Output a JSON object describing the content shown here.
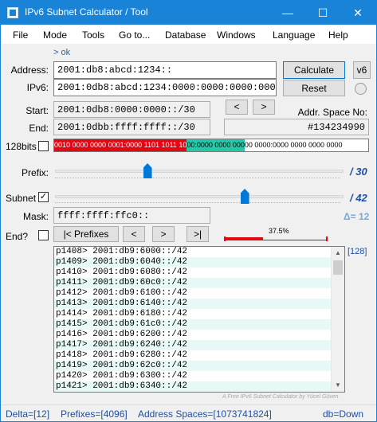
{
  "window": {
    "title": "IPv6 Subnet Calculator / Tool",
    "minimize": "—",
    "maximize": "☐",
    "close": "✕"
  },
  "menu": [
    "File",
    "Mode",
    "Tools",
    "Go to...",
    "Database",
    "Windows",
    "Language",
    "Help"
  ],
  "ok_link": "> ok",
  "address": {
    "label": "Address:",
    "value": "2001:db8:abcd:1234::"
  },
  "ipv6": {
    "label": "IPv6:",
    "value": "2001:0db8:abcd:1234:0000:0000:0000:0000"
  },
  "buttons": {
    "calculate": "Calculate",
    "reset": "Reset",
    "v6": "v6"
  },
  "start": {
    "label": "Start:",
    "value": "2001:0db8:0000:0000::/30"
  },
  "end": {
    "label": "End:",
    "value": "2001:0dbb:ffff:ffff::/30"
  },
  "addr_space": {
    "label": "Addr. Space No:",
    "value": "#134234990"
  },
  "bits128": {
    "label": "128bits",
    "red": "0010 0000 0000 0001:0000 1101 1011 10",
    "green": "00:0000 0000 000",
    "rest": "00 0000:0000 0000 0000 0000",
    "colors": {
      "red": "#e30613",
      "green": "#23c9a9"
    }
  },
  "prefix": {
    "label": "Prefix:",
    "value": "/ 30",
    "level": 30,
    "max": 64
  },
  "subnet": {
    "label": "Subnet",
    "checked": "✓",
    "value": "/ 42",
    "level": 42,
    "max": 64
  },
  "mask": {
    "label": "Mask:",
    "value": "ffff:ffff:ffc0::"
  },
  "delta": {
    "value": "Δ= 12"
  },
  "end_nav": {
    "label": "End?",
    "prefixes": "|< Prefixes",
    "prev": "<",
    "next": ">",
    "last": ">|"
  },
  "progress": {
    "percent_label": "37.5%",
    "fraction": 0.375,
    "color": "#e30613"
  },
  "list_count": "[128]",
  "list": [
    "p1408> 2001:db9:6000::/42",
    "p1409> 2001:db9:6040::/42",
    "p1410> 2001:db9:6080::/42",
    "p1411> 2001:db9:60c0::/42",
    "p1412> 2001:db9:6100::/42",
    "p1413> 2001:db9:6140::/42",
    "p1414> 2001:db9:6180::/42",
    "p1415> 2001:db9:61c0::/42",
    "p1416> 2001:db9:6200::/42",
    "p1417> 2001:db9:6240::/42",
    "p1418> 2001:db9:6280::/42",
    "p1419> 2001:db9:62c0::/42",
    "p1420> 2001:db9:6300::/42",
    "p1421> 2001:db9:6340::/42"
  ],
  "credit": "A Free IPv6 Subnet Calculator by Yücel Güven",
  "status": {
    "delta": "Delta=[12]",
    "prefixes": "Prefixes=[4096]",
    "address_spaces": "Address Spaces=[1073741824]",
    "db": "db=Down"
  }
}
